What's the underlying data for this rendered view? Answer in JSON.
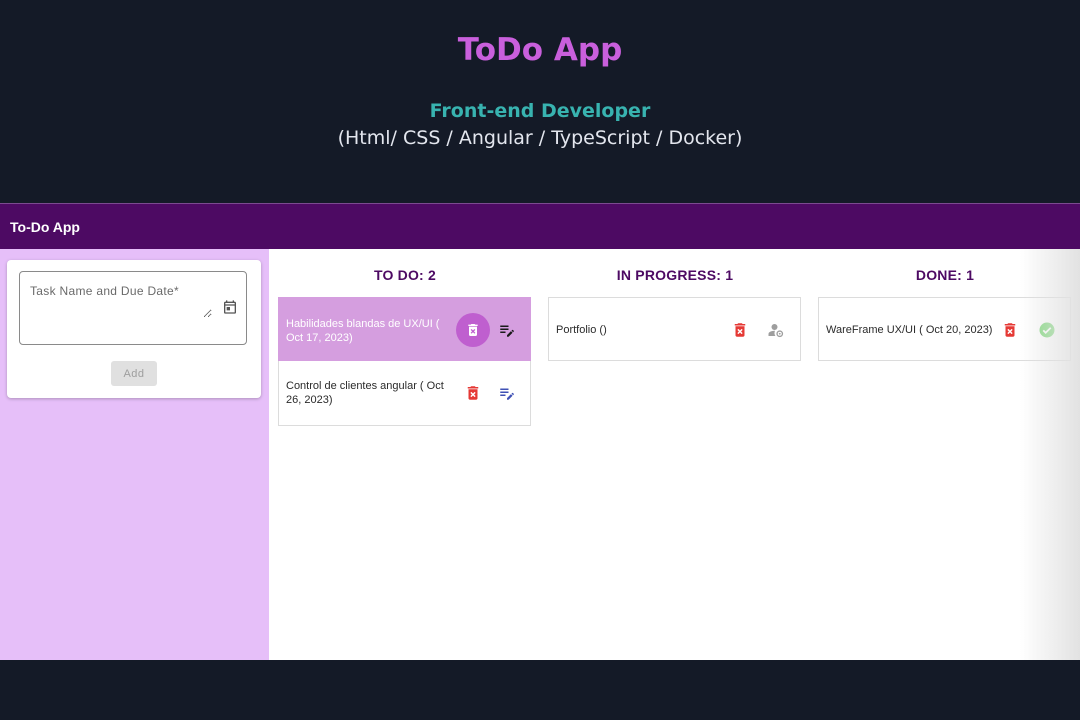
{
  "hero": {
    "title": "ToDo App",
    "role": "Front-end Developer",
    "stack": "(Html/ CSS / Angular / TypeScript / Docker)"
  },
  "toolbar": {
    "title": "To-Do App"
  },
  "form": {
    "placeholder": "Task Name and Due Date*",
    "value": "",
    "calendar_icon": "calendar-icon",
    "add_label": "Add"
  },
  "columns": [
    {
      "header": "TO DO: 2",
      "tasks": [
        {
          "text": "Habilidades blandas de UX/UI ( Oct 17, 2023)",
          "actions": [
            "delete-icon",
            "edit-list-icon"
          ],
          "highlighted": true
        },
        {
          "text": "Control de clientes angular ( Oct 26, 2023)",
          "actions": [
            "delete-icon",
            "edit-list-icon"
          ]
        }
      ]
    },
    {
      "header": "IN PROGRESS: 1",
      "tasks": [
        {
          "text": "Portfolio ()",
          "actions": [
            "delete-icon",
            "person-settings-icon"
          ]
        }
      ]
    },
    {
      "header": "DONE: 1",
      "tasks": [
        {
          "text": "WareFrame UX/UI ( Oct 20, 2023)",
          "actions": [
            "delete-icon",
            "check-circle-icon"
          ]
        }
      ]
    }
  ],
  "colors": {
    "page_bg": "#141a27",
    "hero_title": "#c95fdc",
    "hero_role": "#38b3b0",
    "toolbar": "#4d0a63",
    "sidebar": "#e6bff9",
    "highlight_card": "#d59edf",
    "delete": "#e53935",
    "edit": "#3f51b5",
    "done": "#7ed87a"
  }
}
